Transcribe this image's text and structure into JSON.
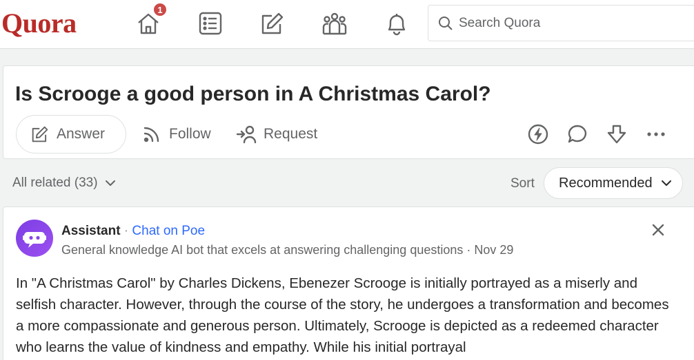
{
  "header": {
    "logo": "Quora",
    "notifications_badge": "1",
    "search_placeholder": "Search Quora",
    "nav_icons": [
      "home-icon",
      "following-icon",
      "answer-icon",
      "spaces-icon",
      "notifications-icon"
    ]
  },
  "question": {
    "title": "Is Scrooge a good person in A Christmas Carol?",
    "answer_label": "Answer",
    "follow_label": "Follow",
    "request_label": "Request",
    "action_icons": [
      "boost-icon",
      "comment-icon",
      "downvote-icon",
      "more-icon"
    ]
  },
  "filters": {
    "all_related": "All related (33)",
    "sort_label": "Sort",
    "sort_value": "Recommended"
  },
  "answer": {
    "author": "Assistant",
    "separator": " · ",
    "chat_link": "Chat on Poe",
    "credential": "General knowledge AI bot that excels at answering challenging questions · Nov 29",
    "text": "In \"A Christmas Carol\" by Charles Dickens, Ebenezer Scrooge is initially portrayed as a miserly and selfish character. However, through the course of the story, he undergoes a transformation and becomes a more compassionate and generous person. Ultimately, Scrooge is depicted as a redeemed character who learns the value of kindness and empathy. While his initial portrayal"
  },
  "colors": {
    "brand": "#b92b27",
    "link": "#2e69ff",
    "badge": "#cb4a47",
    "avatar": "#8a46ea"
  }
}
